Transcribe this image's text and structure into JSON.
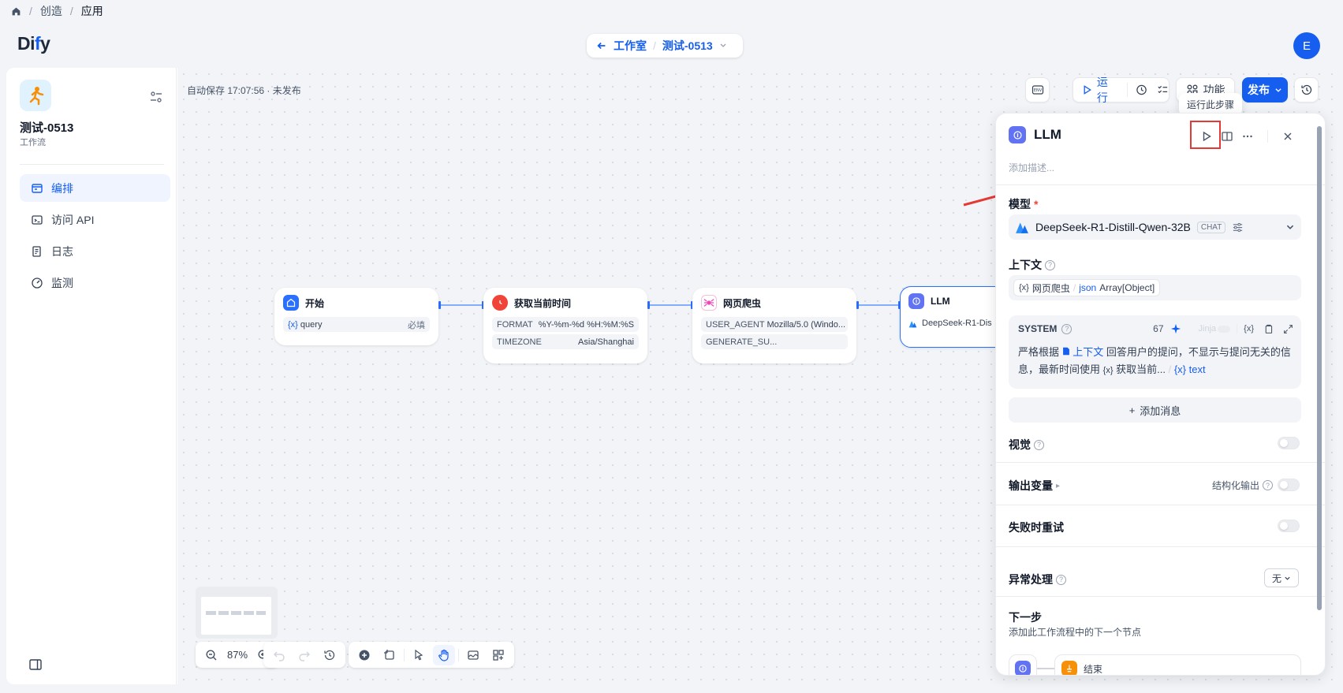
{
  "breadcrumb": {
    "home_icon": "home-icon",
    "items": [
      "创造",
      "应用"
    ]
  },
  "header": {
    "logo_main": "Di",
    "logo_accent": "f",
    "logo_end": "y",
    "back_label": "工作室",
    "app_name": "测试-0513",
    "avatar_letter": "E"
  },
  "sidebar": {
    "app_name": "测试-0513",
    "app_type": "工作流",
    "items": [
      {
        "label": "编排",
        "icon": "layout-icon",
        "active": true
      },
      {
        "label": "访问 API",
        "icon": "terminal-icon",
        "active": false
      },
      {
        "label": "日志",
        "icon": "log-icon",
        "active": false
      },
      {
        "label": "监测",
        "icon": "gauge-icon",
        "active": false
      }
    ]
  },
  "canvas": {
    "autosave": "自动保存 17:07:56 · 未发布",
    "toolbar": {
      "env": "ENV",
      "run": "运行",
      "features": "功能",
      "publish": "发布"
    },
    "tooltip": "运行此步骤",
    "zoom": "87%",
    "nodes": {
      "start": {
        "title": "开始",
        "var": "query",
        "required": "必填"
      },
      "time": {
        "title": "获取当前时间",
        "rows": [
          {
            "k": "FORMAT",
            "v": "%Y-%m-%d %H:%M:%S"
          },
          {
            "k": "TIMEZONE",
            "v": "Asia/Shanghai"
          }
        ]
      },
      "crawler": {
        "title": "网页爬虫",
        "rows": [
          {
            "k": "USER_AGENT",
            "v": "Mozilla/5.0 (Windo..."
          },
          {
            "k": "GENERATE_SU...",
            "v": ""
          }
        ]
      },
      "llm": {
        "title": "LLM",
        "model": "DeepSeek-R1-Dis"
      }
    }
  },
  "panel": {
    "title": "LLM",
    "desc_placeholder": "添加描述...",
    "model_label": "模型",
    "model_name": "DeepSeek-R1-Distill-Qwen-32B",
    "model_tag": "CHAT",
    "context_label": "上下文",
    "context_chip_node": "网页爬虫",
    "context_chip_type": "json",
    "context_chip_var": "Array[Object]",
    "system_label": "SYSTEM",
    "system_count": "67",
    "jinja": "Jinja",
    "system_text_1": "严格根据",
    "system_text_ctx": "上下文",
    "system_text_2": "回答用户的提问，不显示与提问无关的信息，最新时间使用",
    "system_text_node": "获取当前...",
    "system_text_var": "text",
    "add_message": "添加消息",
    "vision_label": "视觉",
    "output_label": "输出变量",
    "structured_output": "结构化输出",
    "retry_label": "失败时重试",
    "error_label": "异常处理",
    "error_value": "无",
    "next_label": "下一步",
    "next_desc": "添加此工作流程中的下一个节点",
    "next_node": "结束"
  },
  "colors": {
    "accent": "#155eef",
    "highlight": "#e53935"
  }
}
